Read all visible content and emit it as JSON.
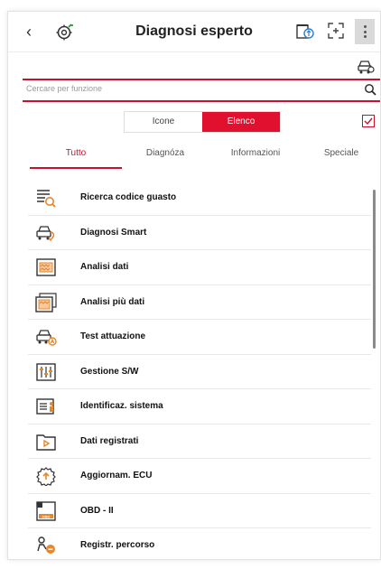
{
  "header": {
    "back_glyph": "‹",
    "title": "Diagnosi esperto",
    "icons": [
      "vci-connection-icon",
      "database-icon",
      "fullscreen-icon",
      "more-vertical-icon"
    ]
  },
  "search": {
    "placeholder": "Cercare per funzione"
  },
  "view_toggle": {
    "options": [
      "Icone",
      "Elenco"
    ],
    "selected": "Elenco"
  },
  "tabs": {
    "items": [
      "Tutto",
      "Diagnóza",
      "Informazioni",
      "Speciale"
    ],
    "active": "Tutto"
  },
  "list": {
    "items": [
      {
        "label": "Ricerca codice guasto",
        "icon": "fault-code-search-icon"
      },
      {
        "label": "Diagnosi Smart",
        "icon": "smart-diagnosis-car-icon"
      },
      {
        "label": "Analisi dati",
        "icon": "data-analysis-icon"
      },
      {
        "label": "Analisi più dati",
        "icon": "multi-data-analysis-icon"
      },
      {
        "label": "Test attuazione",
        "icon": "actuation-test-car-icon"
      },
      {
        "label": "Gestione S/W",
        "icon": "software-management-icon"
      },
      {
        "label": "Identificaz. sistema",
        "icon": "system-identification-icon"
      },
      {
        "label": "Dati registrati",
        "icon": "recorded-data-folder-icon"
      },
      {
        "label": "Aggiornam. ECU",
        "icon": "ecu-update-icon"
      },
      {
        "label": "OBD - II",
        "icon": "obd-ii-icon"
      },
      {
        "label": "Registr. percorso",
        "icon": "route-recording-icon"
      }
    ]
  },
  "colors": {
    "accent": "#c8102e",
    "icon_orange": "#e8862a"
  }
}
